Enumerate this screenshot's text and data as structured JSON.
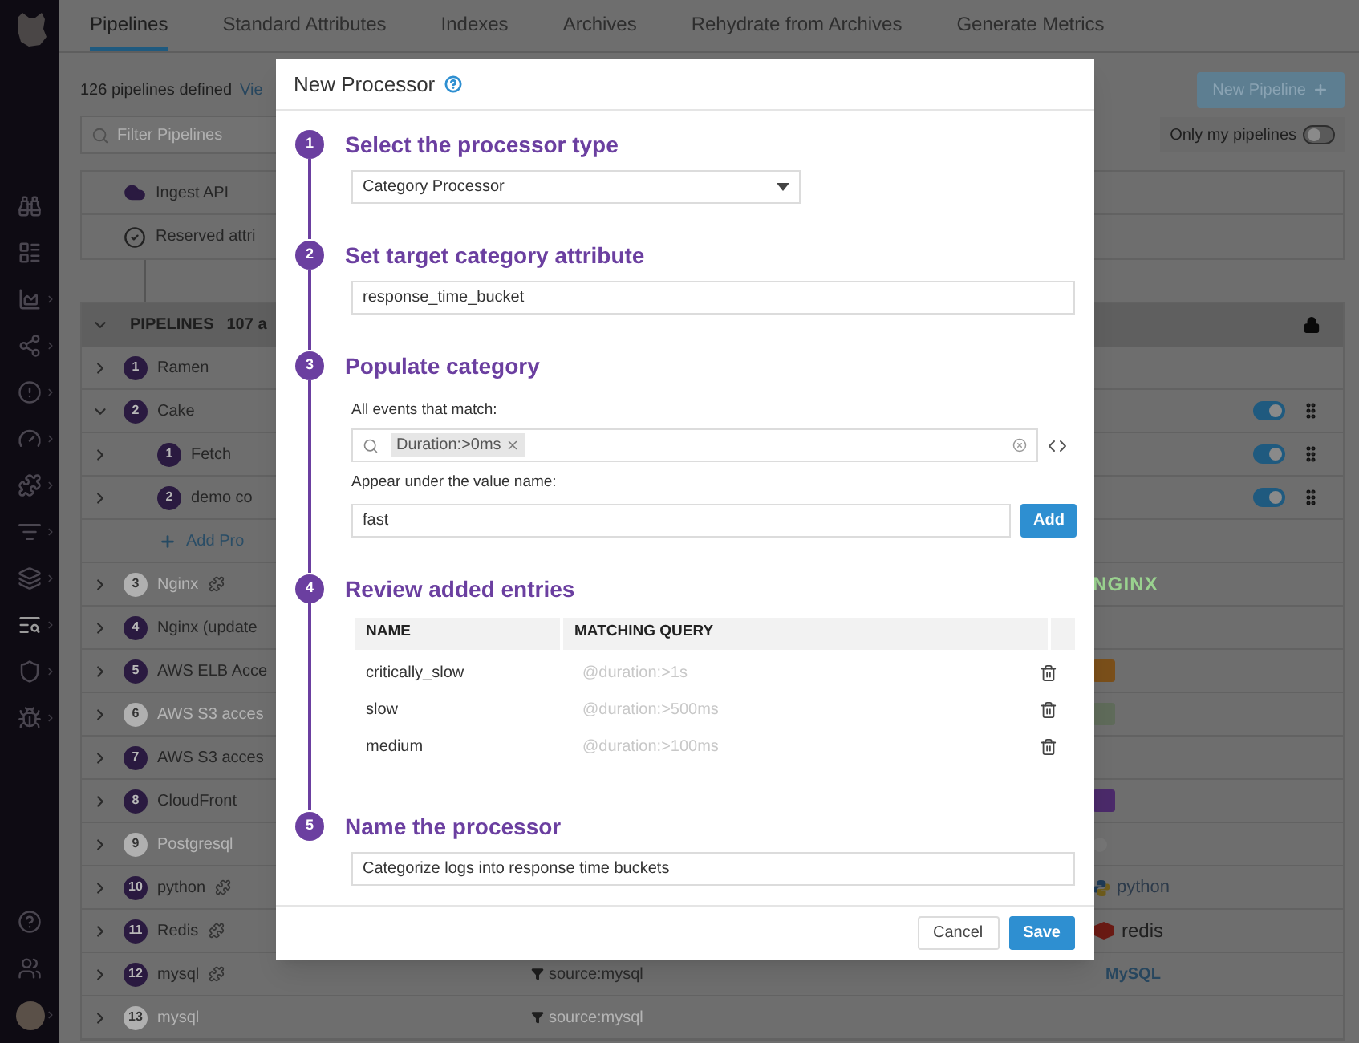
{
  "sidebar": {
    "items": [
      {
        "kind": "binoculars",
        "selected": false,
        "submenu": false
      },
      {
        "kind": "list",
        "selected": false,
        "submenu": false
      },
      {
        "kind": "chart",
        "selected": false,
        "submenu": true
      },
      {
        "kind": "nodes",
        "selected": false,
        "submenu": true
      },
      {
        "kind": "alert",
        "selected": false,
        "submenu": true
      },
      {
        "kind": "gauge",
        "selected": false,
        "submenu": true
      },
      {
        "kind": "puzzle",
        "selected": false,
        "submenu": true
      },
      {
        "kind": "filter",
        "selected": false,
        "submenu": true
      },
      {
        "kind": "layers",
        "selected": false,
        "submenu": true
      },
      {
        "kind": "logs",
        "selected": true,
        "submenu": true
      },
      {
        "kind": "shield",
        "selected": false,
        "submenu": true
      },
      {
        "kind": "bug",
        "selected": false,
        "submenu": true
      }
    ],
    "bottom": [
      {
        "kind": "help",
        "submenu": false
      },
      {
        "kind": "users",
        "submenu": false
      },
      {
        "kind": "avatar",
        "submenu": true
      }
    ]
  },
  "tabs": [
    {
      "label": "Pipelines",
      "selected": true
    },
    {
      "label": "Standard Attributes",
      "selected": false
    },
    {
      "label": "Indexes",
      "selected": false
    },
    {
      "label": "Archives",
      "selected": false
    },
    {
      "label": "Rehydrate from Archives",
      "selected": false
    },
    {
      "label": "Generate Metrics",
      "selected": false
    }
  ],
  "summary": {
    "count": "126 pipelines defined",
    "link": "Vie"
  },
  "new_button": "New Pipeline",
  "filter": {
    "placeholder": "Filter Pipelines"
  },
  "only_mine": {
    "label": "Only my pipelines",
    "on": false
  },
  "preprocessing": [
    {
      "kind": "cloud",
      "label": "Ingest API"
    },
    {
      "kind": "check",
      "label": "Reserved attri"
    }
  ],
  "pipelines_header": {
    "title": "PIPELINES",
    "count": "107 a"
  },
  "rows": [
    {
      "kind": "pipeline",
      "number": "1",
      "name": "Ramen",
      "expanded": false,
      "disabled": false
    },
    {
      "kind": "pipeline",
      "number": "2",
      "name": "Cake",
      "expanded": true,
      "disabled": false,
      "toggle_on": true
    },
    {
      "kind": "processor",
      "number": "1",
      "name": "Fetch",
      "expanded": false,
      "disabled": false,
      "toggle_on": true
    },
    {
      "kind": "processor",
      "number": "2",
      "name": "demo co",
      "expanded": false,
      "disabled": false,
      "toggle_on": true
    },
    {
      "kind": "add",
      "label": "Add Pro"
    },
    {
      "kind": "pipeline",
      "number": "3",
      "name": "Nginx",
      "expanded": false,
      "disabled": true,
      "integration": true,
      "logo": {
        "kind": "nginx",
        "text": "NGINX"
      }
    },
    {
      "kind": "pipeline",
      "number": "4",
      "name": "Nginx (update",
      "expanded": false,
      "disabled": false
    },
    {
      "kind": "pipeline",
      "number": "5",
      "name": "AWS ELB Acce",
      "expanded": false,
      "disabled": false,
      "logo": {
        "kind": "elb"
      }
    },
    {
      "kind": "pipeline",
      "number": "6",
      "name": "AWS S3 acces",
      "expanded": false,
      "disabled": true,
      "logo": {
        "kind": "s3"
      }
    },
    {
      "kind": "pipeline",
      "number": "7",
      "name": "AWS S3 acces",
      "expanded": false,
      "disabled": false
    },
    {
      "kind": "pipeline",
      "number": "8",
      "name": "CloudFront",
      "expanded": false,
      "disabled": false,
      "logo": {
        "kind": "cloudfront"
      }
    },
    {
      "kind": "pipeline",
      "number": "9",
      "name": "Postgresql",
      "expanded": false,
      "disabled": true,
      "logo": {
        "kind": "postgres"
      }
    },
    {
      "kind": "pipeline",
      "number": "10",
      "name": "python",
      "expanded": false,
      "disabled": false,
      "integration": true,
      "logo": {
        "kind": "python",
        "text": "python"
      }
    },
    {
      "kind": "pipeline",
      "number": "11",
      "name": "Redis",
      "expanded": false,
      "disabled": false,
      "integration": true,
      "logo": {
        "kind": "redis",
        "text": "redis"
      }
    },
    {
      "kind": "pipeline",
      "number": "12",
      "name": "mysql",
      "expanded": false,
      "disabled": false,
      "integration": true,
      "filter": "source:mysql",
      "logo": {
        "kind": "mysql",
        "text": "MySQL"
      }
    },
    {
      "kind": "pipeline",
      "number": "13",
      "name": "mysql",
      "expanded": false,
      "disabled": true,
      "filter": "source:mysql"
    }
  ],
  "modal": {
    "title": "New Processor",
    "steps": [
      {
        "kind": "select",
        "number": "1",
        "title": "Select the processor type",
        "value": "Category Processor"
      },
      {
        "kind": "text",
        "number": "2",
        "title": "Set target category attribute",
        "value": "response_time_bucket"
      },
      {
        "kind": "populate",
        "number": "3",
        "title": "Populate category",
        "query_label": "All events that match:",
        "query_chip": "Duration:>0ms",
        "value_label": "Appear under the value name:",
        "value": "fast",
        "add_button": "Add"
      },
      {
        "kind": "table",
        "number": "4",
        "title": "Review added entries",
        "columns": [
          "NAME",
          "MATCHING QUERY"
        ],
        "entries": [
          {
            "name": "critically_slow",
            "query": "@duration:>1s"
          },
          {
            "name": "slow",
            "query": "@duration:>500ms"
          },
          {
            "name": "medium",
            "query": "@duration:>100ms"
          }
        ]
      },
      {
        "kind": "text",
        "number": "5",
        "title": "Name the processor",
        "value": "Categorize logs into response time buckets"
      }
    ],
    "buttons": [
      {
        "kind": "secondary",
        "label": "Cancel"
      },
      {
        "kind": "primary",
        "label": "Save"
      }
    ]
  }
}
